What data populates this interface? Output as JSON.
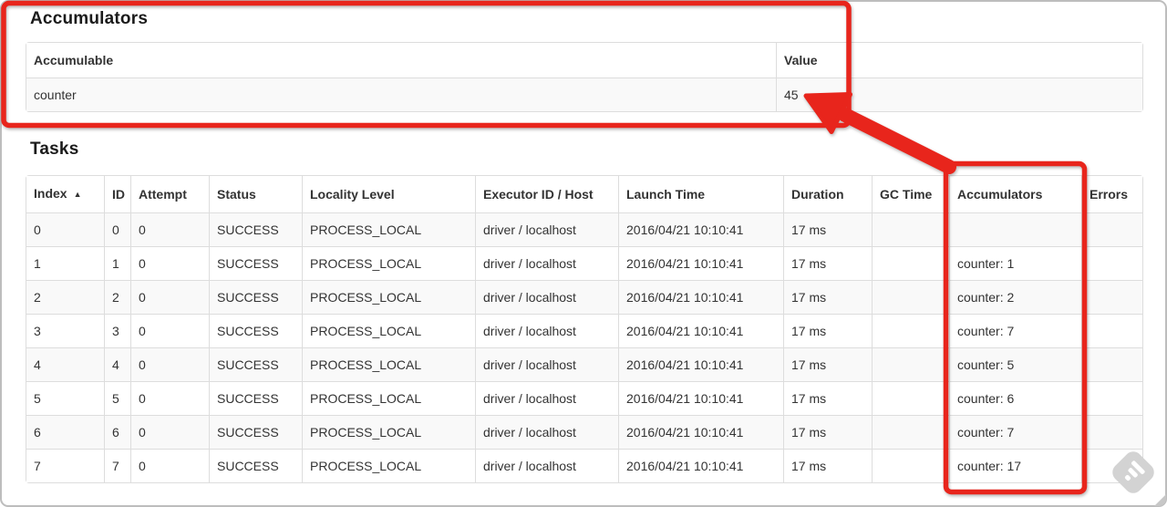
{
  "page": {
    "accumulators_section": {
      "heading": "Accumulators",
      "table": {
        "columns": {
          "accumulable": "Accumulable",
          "value": "Value"
        },
        "row": {
          "accumulable": "counter",
          "value": "45"
        }
      }
    },
    "tasks_section": {
      "heading": "Tasks",
      "table": {
        "columns": [
          "Index",
          "ID",
          "Attempt",
          "Status",
          "Locality Level",
          "Executor ID / Host",
          "Launch Time",
          "Duration",
          "GC Time",
          "Accumulators",
          "Errors"
        ],
        "sort_icon": "▲",
        "rows": [
          [
            "0",
            "0",
            "0",
            "SUCCESS",
            "PROCESS_LOCAL",
            "driver / localhost",
            "2016/04/21 10:10:41",
            "17 ms",
            "",
            "",
            ""
          ],
          [
            "1",
            "1",
            "0",
            "SUCCESS",
            "PROCESS_LOCAL",
            "driver / localhost",
            "2016/04/21 10:10:41",
            "17 ms",
            "",
            "counter: 1",
            ""
          ],
          [
            "2",
            "2",
            "0",
            "SUCCESS",
            "PROCESS_LOCAL",
            "driver / localhost",
            "2016/04/21 10:10:41",
            "17 ms",
            "",
            "counter: 2",
            ""
          ],
          [
            "3",
            "3",
            "0",
            "SUCCESS",
            "PROCESS_LOCAL",
            "driver / localhost",
            "2016/04/21 10:10:41",
            "17 ms",
            "",
            "counter: 7",
            ""
          ],
          [
            "4",
            "4",
            "0",
            "SUCCESS",
            "PROCESS_LOCAL",
            "driver / localhost",
            "2016/04/21 10:10:41",
            "17 ms",
            "",
            "counter: 5",
            ""
          ],
          [
            "5",
            "5",
            "0",
            "SUCCESS",
            "PROCESS_LOCAL",
            "driver / localhost",
            "2016/04/21 10:10:41",
            "17 ms",
            "",
            "counter: 6",
            ""
          ],
          [
            "6",
            "6",
            "0",
            "SUCCESS",
            "PROCESS_LOCAL",
            "driver / localhost",
            "2016/04/21 10:10:41",
            "17 ms",
            "",
            "counter: 7",
            ""
          ],
          [
            "7",
            "7",
            "0",
            "SUCCESS",
            "PROCESS_LOCAL",
            "driver / localhost",
            "2016/04/21 10:10:41",
            "17 ms",
            "",
            "counter: 17",
            ""
          ]
        ]
      }
    }
  },
  "annotations": {
    "accent_color": "#e8251c",
    "boxes": [
      "accumulators-section",
      "accumulators-column"
    ],
    "arrow_points_at": "45"
  },
  "colors": {
    "table_border": "#dddddd",
    "row_stripe": "#f9f9f9",
    "text": "#333333"
  }
}
